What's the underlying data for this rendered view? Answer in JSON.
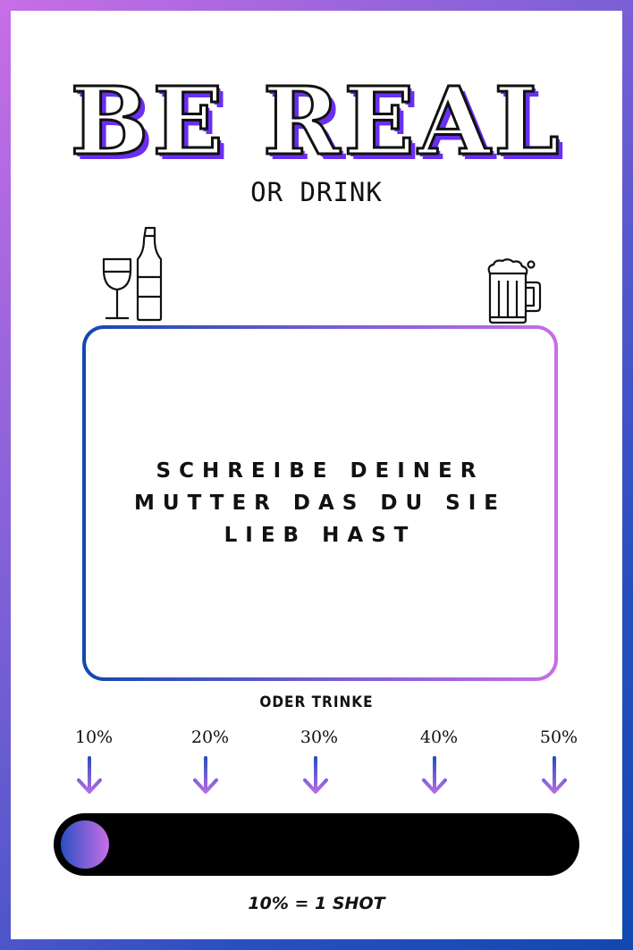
{
  "header": {
    "title": "BE REAL",
    "subtitle": "OR DRINK"
  },
  "icons": {
    "left": "wine-glass-and-bottle-icon",
    "right": "beer-mug-icon"
  },
  "card": {
    "challenge_text": "SCHREIBE DEINER MUTTER DAS DU SIE LIEB HAST"
  },
  "drink": {
    "label": "ODER TRINKE",
    "levels": [
      "10%",
      "20%",
      "30%",
      "40%",
      "50%"
    ],
    "progress_percent": 10,
    "footer": "10% = 1 SHOT"
  },
  "colors": {
    "blue": "#1248b0",
    "purple": "#7a5fd6",
    "pink": "#c86ee6",
    "title_shadow": "#6a2ff0"
  }
}
